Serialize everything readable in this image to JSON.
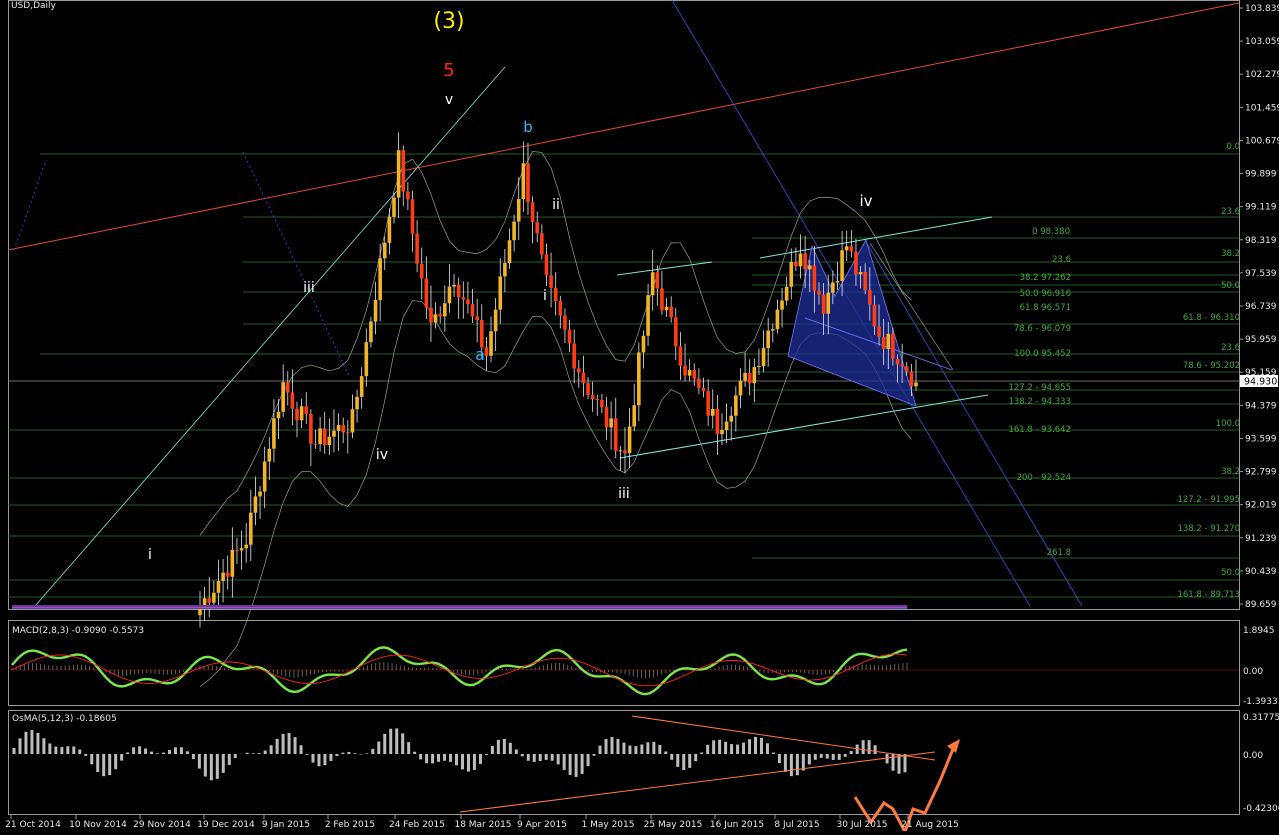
{
  "symbol_title": "USD,Daily",
  "current_price": "94.930",
  "colors": {
    "bull_body": "#f2b52a",
    "bear_body": "#ff3c14",
    "wick": "#e8e8e8",
    "grid": "#2e7d32",
    "fib_text": "#3fa83f",
    "macd_main": "#7be84a",
    "macd_signal": "#ff2020",
    "osma_bar": "#bdbdbd",
    "trend_orange": "#ff7a3c",
    "trend_red": "#e34a2c",
    "channel_cyan": "#7ee8d8",
    "pattern_blue": "#2b3aa6"
  },
  "wave_labels": [
    {
      "text": "(3)",
      "color": "#ffeb00"
    },
    {
      "text": "5",
      "color": "#ff2020"
    },
    {
      "text": "v",
      "color": "#ffffff"
    },
    {
      "text": "b",
      "color": "#2db4ff"
    },
    {
      "text": "ii",
      "color": "#ffffff"
    },
    {
      "text": "iii",
      "color": "#ffffff"
    },
    {
      "text": "a",
      "color": "#2db4ff"
    },
    {
      "text": "i",
      "color": "#ffffff"
    },
    {
      "text": "iv",
      "color": "#ffffff"
    },
    {
      "text": "iii",
      "color": "#ffffff"
    },
    {
      "text": "iv",
      "color": "#ffffff"
    },
    {
      "text": "i",
      "color": "#ffffff"
    }
  ],
  "fib_labels": [
    "0.0",
    "23.6",
    "0 98.380",
    "38.2",
    "23.6",
    "38.2 97.262",
    "50.0",
    "50.0 96.916",
    "61.8 96.571",
    "61.8 - 96.310",
    "78.6 - 96.079",
    "23.6",
    "100.0 95.452",
    "78.6 - 95.202",
    "127.2 - 94.655",
    "138.2 - 94.333",
    "100.0",
    "161.8 - 93.642",
    "38.2",
    "200 - 92.524",
    "127.2 - 91.995",
    "138.2 - 91.270",
    "261.8",
    "50.0",
    "161.8 - 89.713"
  ],
  "macd": {
    "label": "MACD(2,8,3) -0.9090 -0.5573",
    "axis": [
      "1.8945",
      "0.00",
      "-1.3933"
    ]
  },
  "osma": {
    "label": "OsMA(5,12,3) -0.18605",
    "axis": [
      "0.31775",
      "0.00",
      "-0.42306"
    ]
  },
  "chart_data": {
    "type": "candlestick",
    "title": "USD,Daily",
    "price_axis_ticks": [
      "103.839",
      "103.059",
      "102.279",
      "101.459",
      "100.679",
      "99.899",
      "99.119",
      "98.319",
      "97.539",
      "96.739",
      "95.959",
      "95.159",
      "94.379",
      "93.599",
      "92.799",
      "92.019",
      "91.239",
      "90.439",
      "89.659"
    ],
    "date_axis_ticks": [
      "21 Oct 2014",
      "10 Nov 2014",
      "29 Nov 2014",
      "19 Dec 2014",
      "9 Jan 2015",
      "2 Feb 2015",
      "24 Feb 2015",
      "18 Mar 2015",
      "9 Apr 2015",
      "1 May 2015",
      "25 May 2015",
      "16 Jun 2015",
      "8 Jul 2015",
      "30 Jul 2015",
      "21 Aug 2015"
    ],
    "ylim": [
      89.659,
      103.839
    ],
    "last_price": 94.93,
    "pivots": [
      {
        "index": 0,
        "close": 89.6
      },
      {
        "index": 10,
        "close": 91.2
      },
      {
        "index": 18,
        "close": 94.9
      },
      {
        "index": 25,
        "close": 93.5
      },
      {
        "index": 33,
        "close": 94.0
      },
      {
        "index": 43,
        "close": 100.2
      },
      {
        "index": 50,
        "close": 96.2
      },
      {
        "index": 55,
        "close": 97.5
      },
      {
        "index": 62,
        "close": 95.6
      },
      {
        "index": 70,
        "close": 100.0
      },
      {
        "index": 75,
        "close": 97.2
      },
      {
        "index": 83,
        "close": 95.0
      },
      {
        "index": 92,
        "close": 93.2
      },
      {
        "index": 98,
        "close": 97.5
      },
      {
        "index": 105,
        "close": 95.3
      },
      {
        "index": 112,
        "close": 93.9
      },
      {
        "index": 120,
        "close": 95.3
      },
      {
        "index": 130,
        "close": 98.2
      },
      {
        "index": 135,
        "close": 96.8
      },
      {
        "index": 140,
        "close": 98.2
      },
      {
        "index": 147,
        "close": 96.1
      },
      {
        "index": 152,
        "close": 95.5
      },
      {
        "index": 155,
        "close": 94.93
      }
    ]
  }
}
